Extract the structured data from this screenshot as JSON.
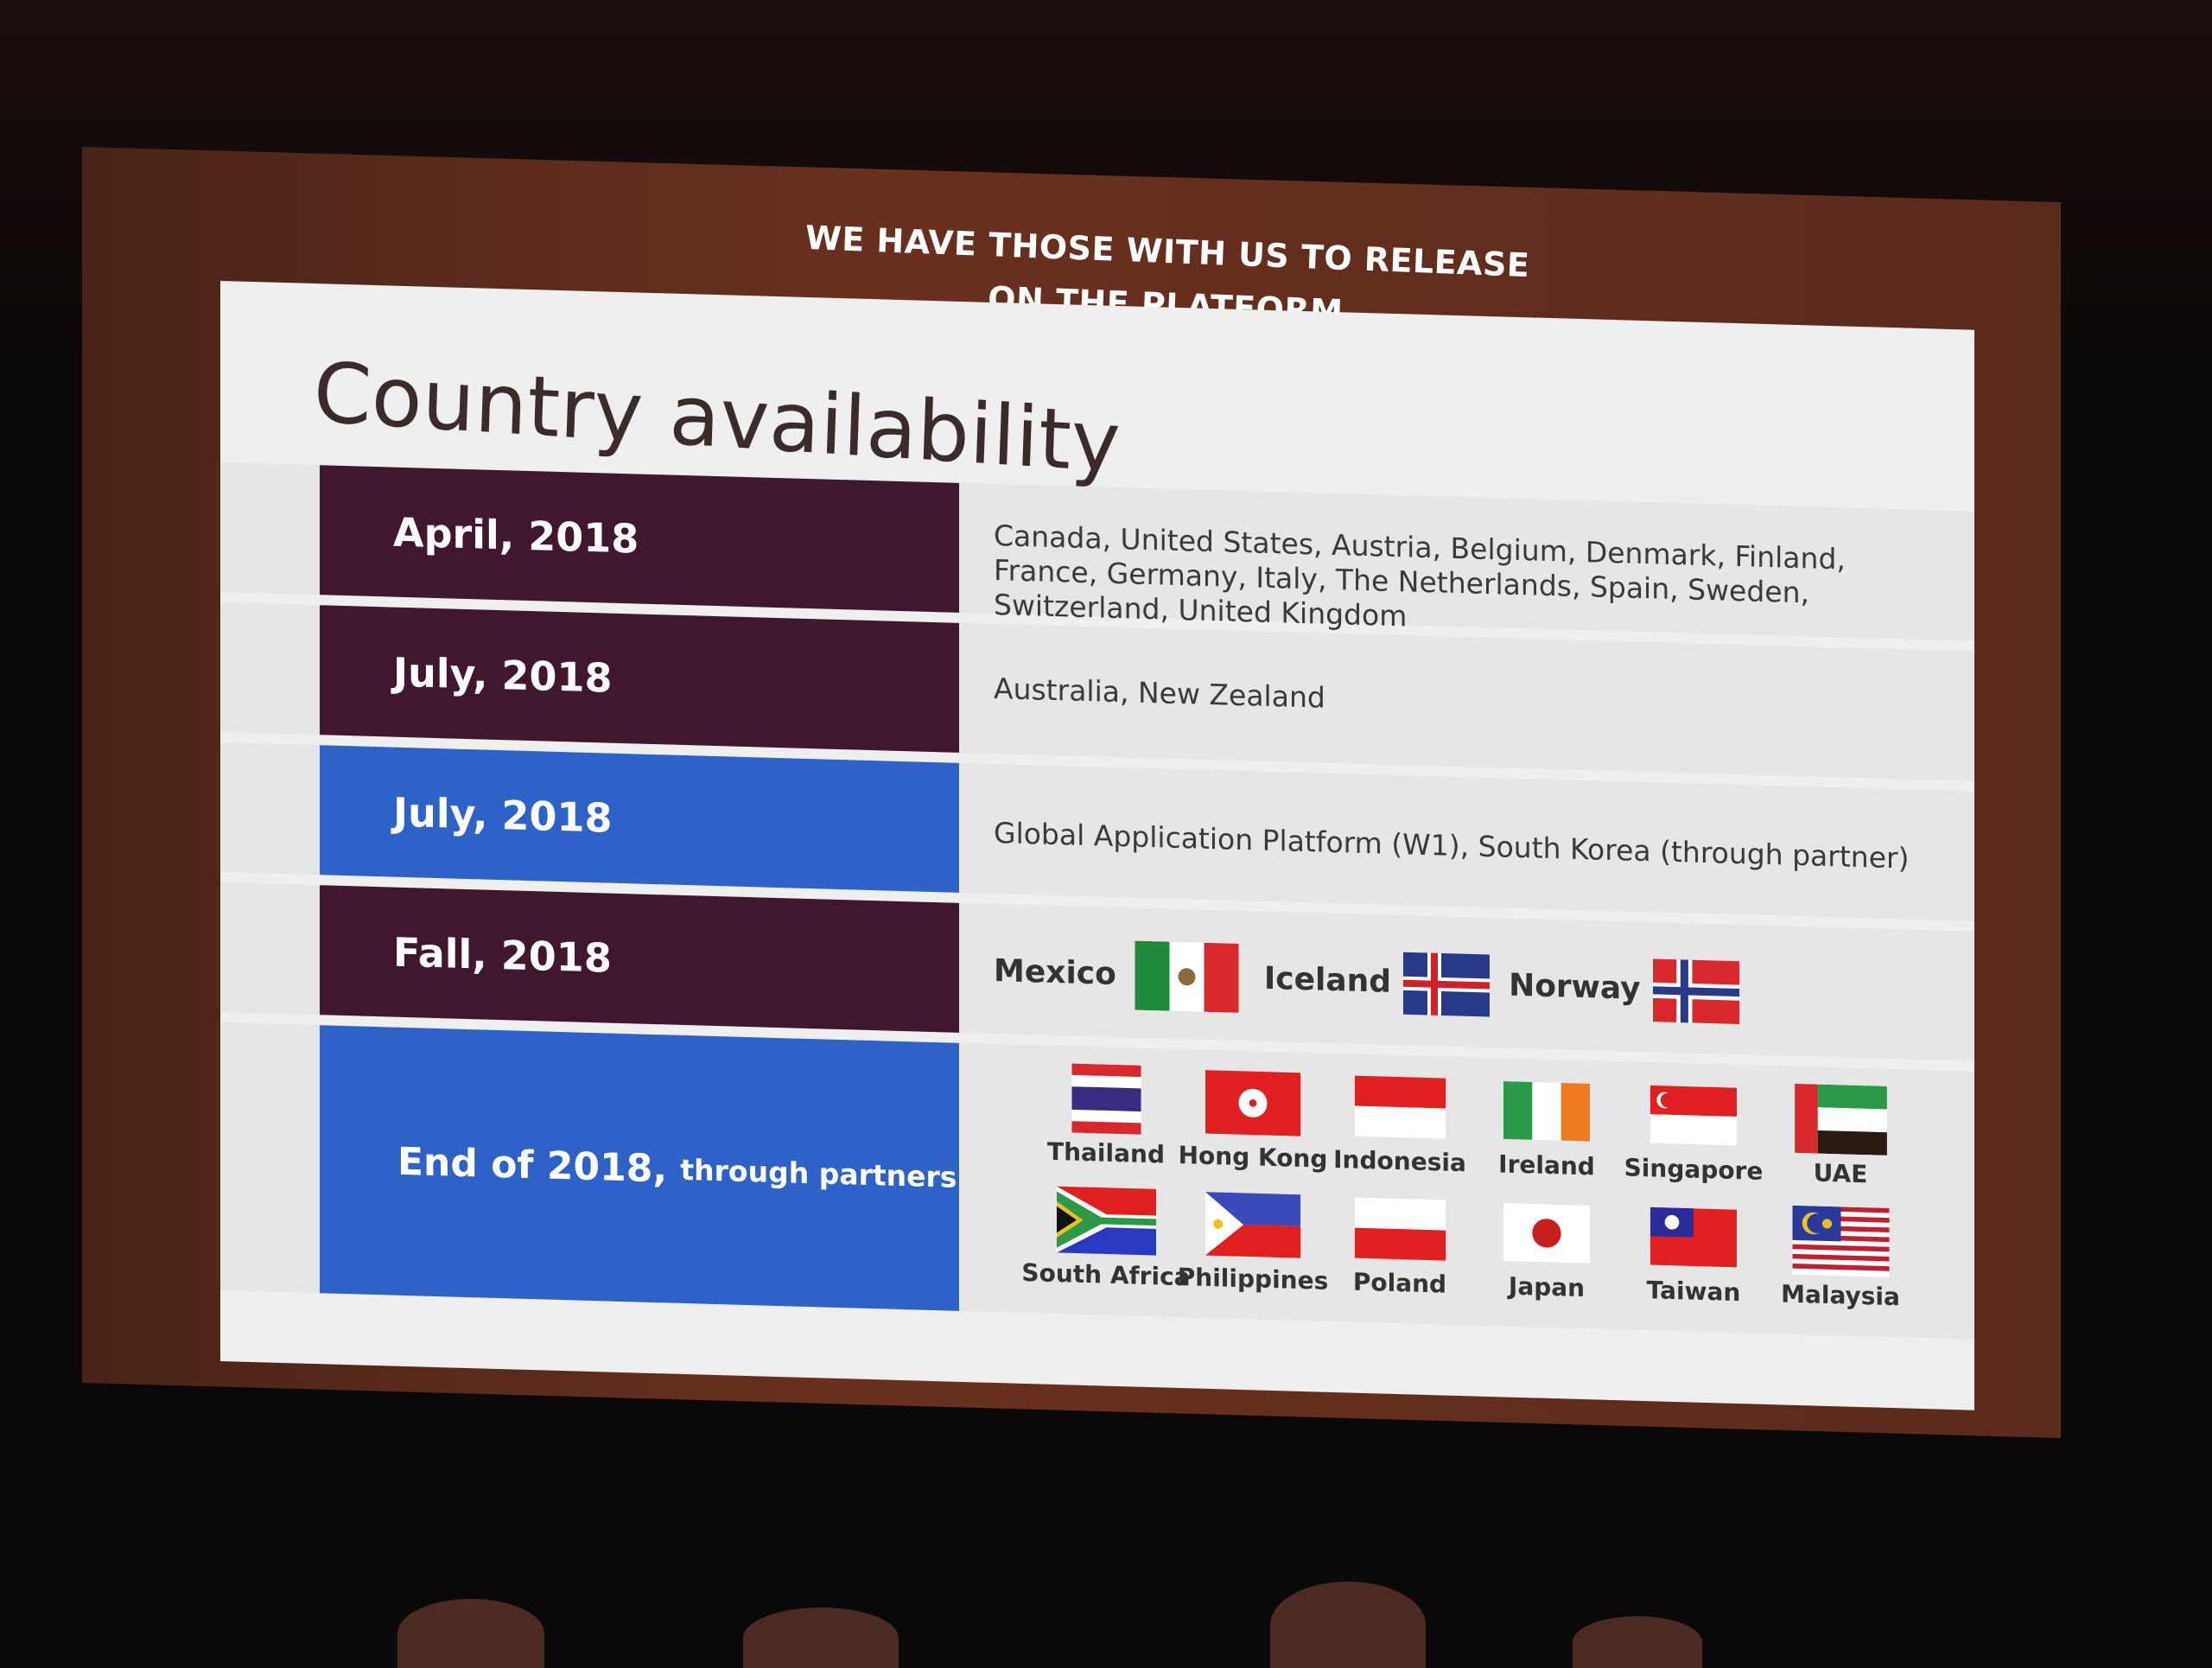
{
  "caption": {
    "line1": "WE HAVE THOSE WITH US TO RELEASE",
    "line2": "ON THE PLATFORM"
  },
  "slide": {
    "title": "Country availability",
    "rows": [
      {
        "label": "April, 2018",
        "color": "#40172e",
        "text": "Canada, United States, Austria, Belgium, Denmark, Finland, France, Germany, Italy, The Netherlands, Spain, Sweden, Switzerland, United Kingdom"
      },
      {
        "label": "July, 2018",
        "color": "#40172e",
        "text": "Australia, New Zealand"
      },
      {
        "label": "July, 2018",
        "color": "#2f62c9",
        "text": "Global Application Platform (W1), South Korea (through partner)"
      },
      {
        "label": "Fall, 2018",
        "color": "#40172e",
        "countries": [
          "Mexico",
          "Iceland",
          "Norway"
        ]
      },
      {
        "label": "End of 2018,",
        "label_suffix": "through partners",
        "color": "#2f62c9",
        "countries": [
          "Thailand",
          "Hong Kong",
          "Indonesia",
          "Ireland",
          "Singapore",
          "UAE",
          "South Africa",
          "Philippines",
          "Poland",
          "Japan",
          "Taiwan",
          "Malaysia"
        ]
      }
    ]
  }
}
